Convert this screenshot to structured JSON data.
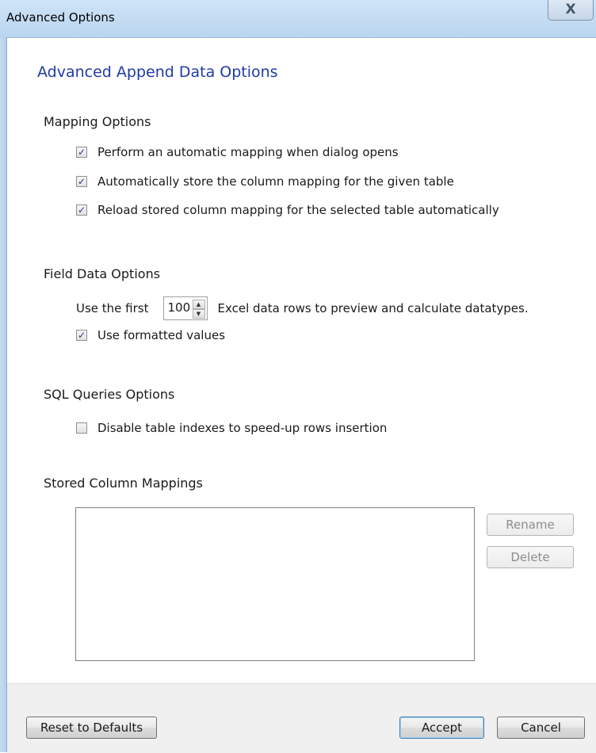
{
  "window": {
    "title": "Advanced Options",
    "close_glyph": "X"
  },
  "heading": "Advanced Append Data Options",
  "mapping": {
    "title": "Mapping Options",
    "options": [
      {
        "label": "Perform an automatic mapping when dialog opens",
        "checked": true
      },
      {
        "label": "Automatically store the column mapping for the given table",
        "checked": true
      },
      {
        "label": "Reload stored column mapping for the selected table automatically",
        "checked": true
      }
    ]
  },
  "field_data": {
    "title": "Field Data Options",
    "rows_prefix": "Use the first",
    "rows_value": "100",
    "rows_suffix": "Excel data rows to preview and calculate datatypes.",
    "formatted_label": "Use formatted values",
    "formatted_checked": true
  },
  "sql": {
    "title": "SQL Queries Options",
    "disable_indexes_label": "Disable table indexes to speed-up rows insertion",
    "disable_indexes_checked": false
  },
  "stored": {
    "title": "Stored Column Mappings",
    "items": [],
    "rename_label": "Rename",
    "delete_label": "Delete"
  },
  "footer": {
    "reset_label": "Reset to Defaults",
    "accept_label": "Accept",
    "cancel_label": "Cancel"
  },
  "icons": {
    "check": "✓",
    "spin_up": "▲",
    "spin_down": "▼"
  }
}
